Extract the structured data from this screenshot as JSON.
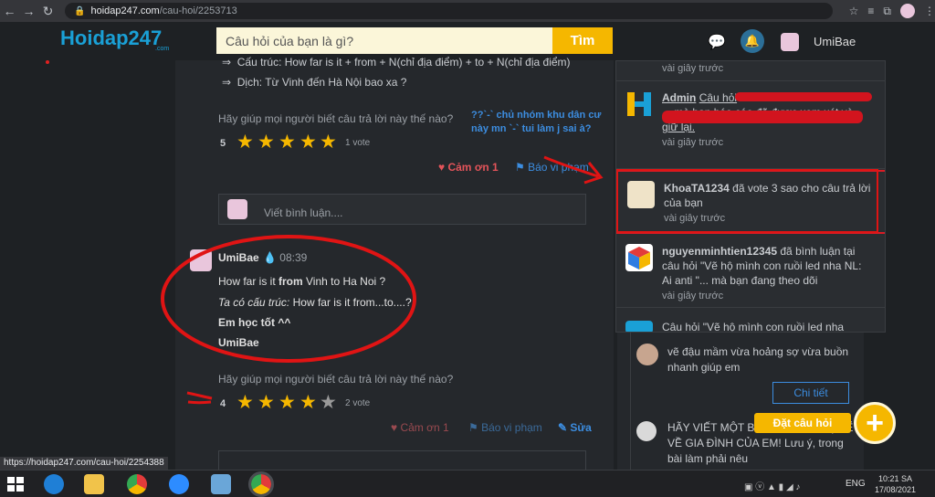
{
  "browser": {
    "url_host": "hoidap247.com",
    "url_path": "/cau-hoi/2253713"
  },
  "header": {
    "logo": "Hoidap247",
    "logo_sub": ".com",
    "search_placeholder": "Câu hỏi của bạn là gì?",
    "search_button": "Tìm",
    "username": "UmiBae"
  },
  "answer1": {
    "line1": "Cấu trúc: How far is it + from + N(chỉ địa điểm) + to + N(chỉ địa điểm)",
    "line2": "Dịch: Từ Vinh đến Hà Nội bao xa ?",
    "help_prompt": "Hãy giúp mọi người biết câu trả lời này thế nào?",
    "rating": "5",
    "votes": "1 vote",
    "thanks": "Cảm ơn 1",
    "report": "Báo vi phạm",
    "side_comment": "??`-` chủ nhóm khu dân cư này mn `-` tui làm j sai à?",
    "comment_placeholder": "Viết bình luận...."
  },
  "answer2": {
    "author": "UmiBae",
    "time": "08:39",
    "line1_pre": "How far is it ",
    "line1_bold": "from",
    "line1_post": " Vinh to Ha Noi ?",
    "line2_italic": "Ta có cấu trúc:",
    "line2_rest": " How far is it from...to....?",
    "line3": "Em học tốt ^^",
    "line4": "UmiBae",
    "help_prompt": "Hãy giúp mọi người biết câu trả lời này thế nào?",
    "rating": "4",
    "votes": "2 vote",
    "thanks": "Cảm ơn 1",
    "report": "Báo vi phạm",
    "edit": "Sửa"
  },
  "notifications": [
    {
      "time": "vài giây trước"
    },
    {
      "user": "Admin",
      "text": "Câu hỏi",
      "text2": "... mà bạn báo cáo đã được xem xét và giữ lại.",
      "time": "vài giây trước"
    },
    {
      "user": "KhoaTA1234",
      "text": " đã vote 3 sao cho câu trả lời của bạn",
      "time": "vài giây trước"
    },
    {
      "user": "nguyenminhtien12345",
      "text": " đã bình luận tại câu hỏi \"Vẽ hộ mình con ruồi led nha NL: Ai anti  \"... mà bạn đang theo dõi",
      "time": "vài giây trước"
    },
    {
      "text": "Câu hỏi \"Vẽ hộ mình con ruồi led nha"
    }
  ],
  "right_panel": {
    "item1": "vẽ đậu mầm vừa hoảng sợ vừa buồn nhanh giúp em",
    "detail_button": "Chi tiết",
    "item2": "HÃY VIẾT MỘT BÀI HẠN ĐỘ DÀI) KỂ VỀ GIA ĐÌNH CỦA EM! Lưu ý, trong bài làm phải nêu",
    "ask_button": "Đặt câu hỏi"
  },
  "status_url": "https://hoidap247.com/cau-hoi/2254388",
  "taskbar": {
    "lang": "ENG",
    "clock_time": "10:21 SA",
    "clock_date": "17/08/2021"
  }
}
